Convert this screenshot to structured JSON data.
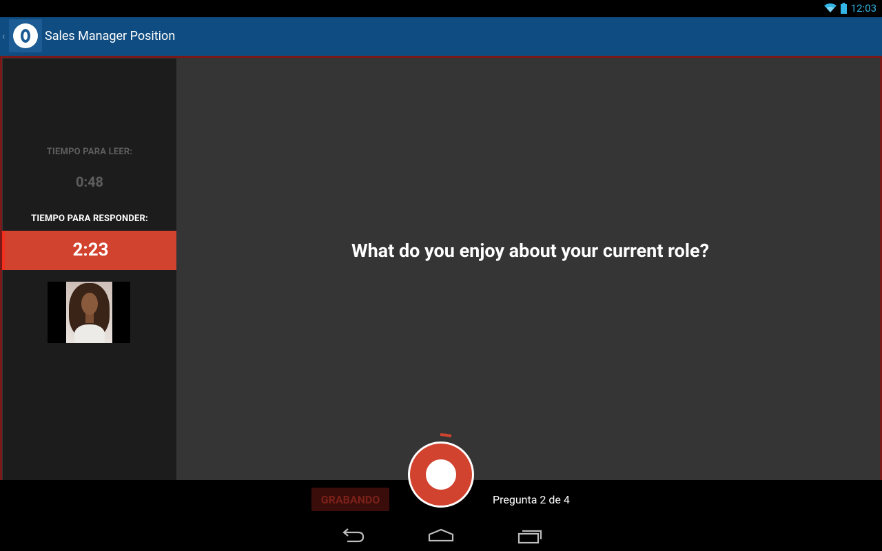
{
  "status_bar": {
    "time": "12:03",
    "icons": [
      "wifi-icon",
      "battery-icon"
    ],
    "accent_color": "#33b5e5"
  },
  "action_bar": {
    "title": "Sales Manager Position",
    "app_icon": "app-logo-icon",
    "background": "#0f4c81"
  },
  "sidebar": {
    "read_label": "TIEMPO PARA LEER:",
    "read_time": "0:48",
    "answer_label": "TIEMPO PARA RESPONDER:",
    "answer_time": "2:23",
    "accent_color": "#d2432f"
  },
  "main": {
    "question": "What do you enjoy about your current role?"
  },
  "bottom": {
    "recording_label": "GRABANDO",
    "question_counter": "Pregunta 2 de 4",
    "record_button_color": "#d2432f"
  },
  "nav_bar": {
    "buttons": [
      "back-icon",
      "home-icon",
      "recents-icon"
    ]
  }
}
